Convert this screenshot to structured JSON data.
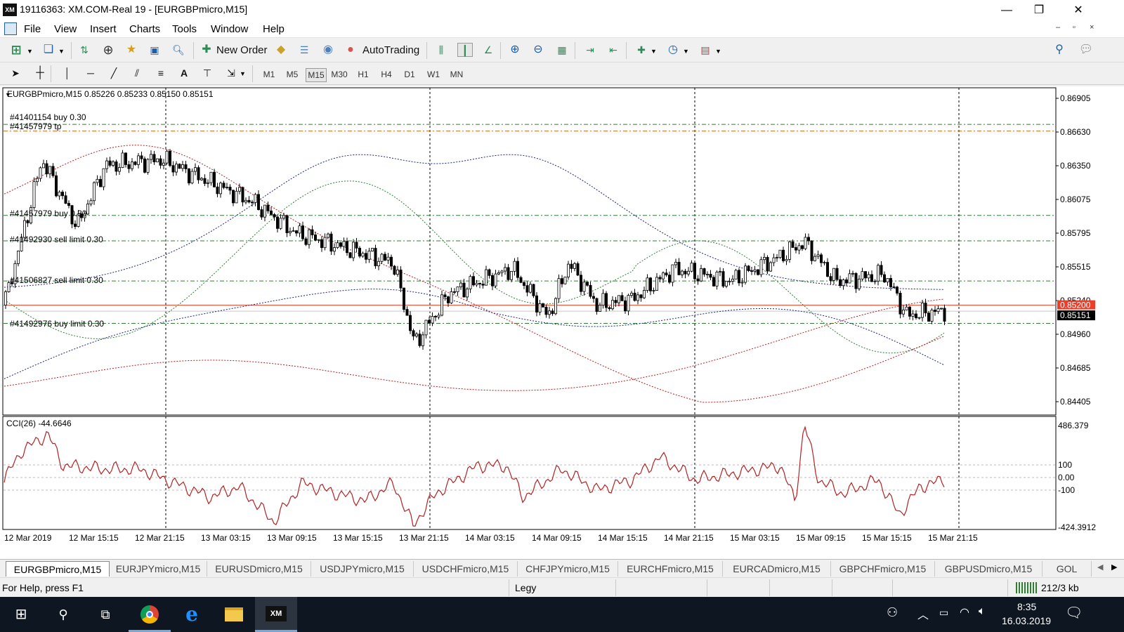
{
  "window": {
    "logo": "XM",
    "title": "19116363: XM.COM-Real 19 - [EURGBPmicro,M15]",
    "minimize": "—",
    "restore": "❐",
    "close": "✕"
  },
  "menu": {
    "items": [
      "File",
      "View",
      "Insert",
      "Charts",
      "Tools",
      "Window",
      "Help"
    ],
    "mdi": [
      "–",
      "▫",
      "×"
    ]
  },
  "toolbar": {
    "new_order": "New Order",
    "autotrading": "AutoTrading"
  },
  "timeframes": [
    "M1",
    "M5",
    "M15",
    "M30",
    "H1",
    "H4",
    "D1",
    "W1",
    "MN"
  ],
  "timeframe_active": "M15",
  "chart_header": "EURGBPmicro,M15  0.85226 0.85233 0.85150 0.85151",
  "order_labels": [
    "#41401154 buy 0.30",
    "#41457979 tp",
    "#41457979 buy 0.30",
    "#41492930 sell limit 0.30",
    "#41506827 sell limit 0.30",
    "#41492976 buy limit 0.30"
  ],
  "price_ticks": [
    "0.86905",
    "0.86630",
    "0.86350",
    "0.86075",
    "0.85795",
    "0.85515",
    "0.85240",
    "0.84960",
    "0.84685",
    "0.84405"
  ],
  "price_markers": {
    "red": "0.85200",
    "black": "0.85151"
  },
  "indicator": {
    "header": "CCI(26) -44.6646",
    "ticks": [
      "486.379",
      "100",
      "0.00",
      "-100",
      "-424.3912"
    ]
  },
  "time_labels": [
    "12 Mar 2019",
    "12 Mar 15:15",
    "12 Mar 21:15",
    "13 Mar 03:15",
    "13 Mar 09:15",
    "13 Mar 15:15",
    "13 Mar 21:15",
    "14 Mar 03:15",
    "14 Mar 09:15",
    "14 Mar 15:15",
    "14 Mar 21:15",
    "15 Mar 03:15",
    "15 Mar 09:15",
    "15 Mar 15:15",
    "15 Mar 21:15"
  ],
  "tabs": [
    "EURGBPmicro,M15",
    "EURJPYmicro,M15",
    "EURUSDmicro,M15",
    "USDJPYmicro,M15",
    "USDCHFmicro,M15",
    "CHFJPYmicro,M15",
    "EURCHFmicro,M15",
    "EURCADmicro,M15",
    "GBPCHFmicro,M15",
    "GBPUSDmicro,M15",
    "GOL"
  ],
  "status": {
    "help": "For Help, press F1",
    "profile": "Legy",
    "traffic": "212/3 kb"
  },
  "taskbar": {
    "time": "8:35",
    "date": "16.03.2019"
  },
  "colors": {
    "bull_candle": "#ffffff",
    "bear_candle": "#000000",
    "level_line": "#2e7d32",
    "tp_line": "#d2691e",
    "cci_line": "#b22222",
    "bb_blue": "#1a237e",
    "bb_green": "#2e7d32",
    "bb_red": "#b71c1c",
    "price_red": "#e8402a"
  }
}
